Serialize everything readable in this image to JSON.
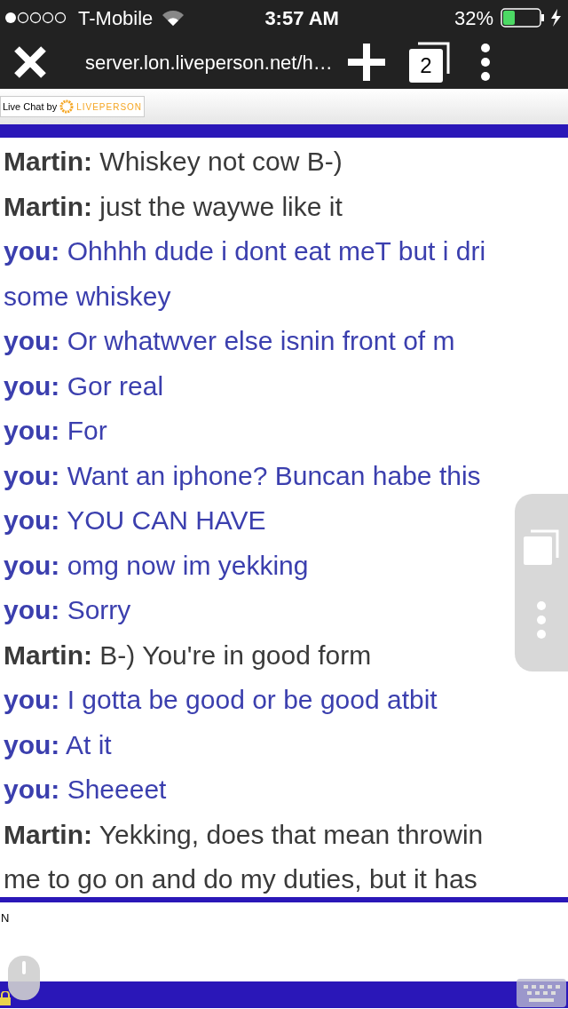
{
  "status_bar": {
    "carrier": "T-Mobile",
    "time": "3:57 AM",
    "battery": "32%"
  },
  "toolbar": {
    "url": "server.lon.liveperson.net/h…",
    "tab_count": "2"
  },
  "branding": {
    "label": "Live Chat by",
    "logo_text": "LIVEPERSON"
  },
  "messages": [
    {
      "kind": "agent",
      "sender": "Martin:",
      "lines": [
        "Whiskey not cow B-)"
      ]
    },
    {
      "kind": "agent",
      "sender": "Martin:",
      "lines": [
        "just the waywe like it"
      ]
    },
    {
      "kind": "visitor",
      "sender": "you:",
      "lines": [
        "Ohhhh dude i dont eat meT but i dri",
        "some whiskey"
      ]
    },
    {
      "kind": "visitor",
      "sender": "you:",
      "lines": [
        "Or whatwver else isnin front of m"
      ]
    },
    {
      "kind": "visitor",
      "sender": "you:",
      "lines": [
        "Gor real"
      ]
    },
    {
      "kind": "visitor",
      "sender": "you:",
      "lines": [
        "For"
      ]
    },
    {
      "kind": "visitor",
      "sender": "you:",
      "lines": [
        "Want an iphone? Buncan habe this"
      ]
    },
    {
      "kind": "visitor",
      "sender": "you:",
      "lines": [
        "YOU CAN HAVE"
      ]
    },
    {
      "kind": "visitor",
      "sender": "you:",
      "lines": [
        "omg now im yekking"
      ]
    },
    {
      "kind": "visitor",
      "sender": "you:",
      "lines": [
        "Sorry"
      ]
    },
    {
      "kind": "agent",
      "sender": "Martin:",
      "lines": [
        "B-) You're in good form"
      ]
    },
    {
      "kind": "visitor",
      "sender": "you:",
      "lines": [
        "I gotta be good or be good atbit"
      ]
    },
    {
      "kind": "visitor",
      "sender": "you:",
      "lines": [
        "At it"
      ]
    },
    {
      "kind": "visitor",
      "sender": "you:",
      "lines": [
        "Sheeeet"
      ]
    },
    {
      "kind": "agent",
      "sender": "Martin:",
      "lines": [
        "Yekking, does that mean throwin",
        "me to go on and do my duties, but it has"
      ]
    }
  ],
  "input": {
    "value": "N"
  }
}
